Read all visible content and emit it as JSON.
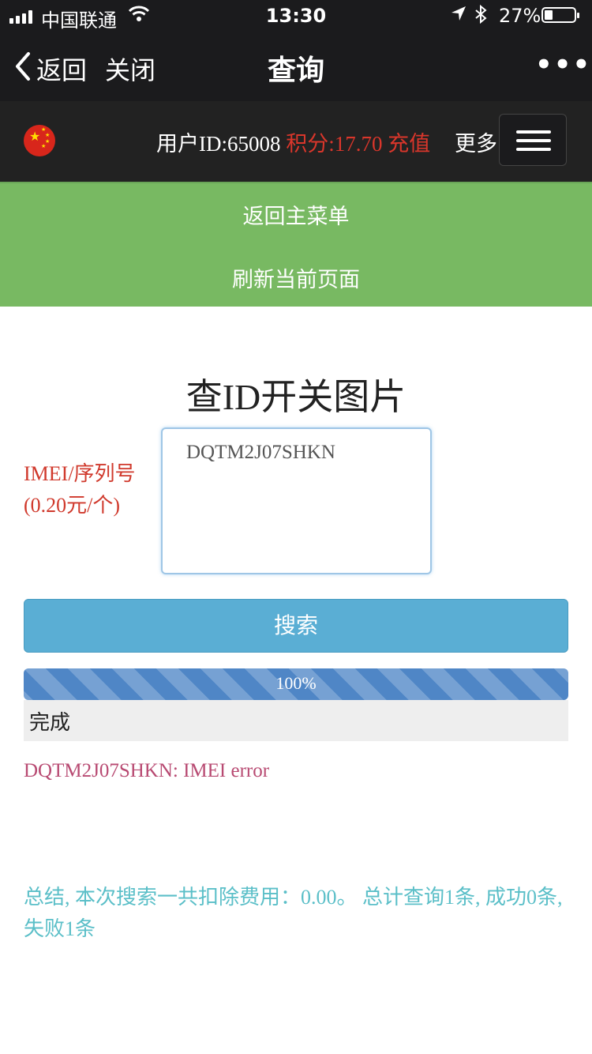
{
  "status_bar": {
    "carrier": "中国联通",
    "time": "13:30",
    "battery": "27%",
    "battery_level": 0.27,
    "icons": [
      "signal-icon",
      "wifi-icon",
      "location-icon",
      "bluetooth-icon",
      "battery-icon"
    ]
  },
  "nav": {
    "back_label": "返回",
    "close_label": "关闭",
    "title": "查询",
    "more_label": "•••"
  },
  "user_bar": {
    "user_id": "用户ID:65008",
    "score": "积分:17.70",
    "recharge": "充值",
    "more": "更多"
  },
  "menu": {
    "items": [
      "返回主菜单",
      "刷新当前页面"
    ]
  },
  "page": {
    "title": "查ID开关图片",
    "imei_label_line1": "IMEI/序列号",
    "imei_label_line2": "(0.20元/个)",
    "imei_value": "DQTM2J07SHKN",
    "search_button": "搜索",
    "progress_percent": 100,
    "progress_text": "100%",
    "status_text": "完成",
    "error_line": "DQTM2J07SHKN: IMEI error",
    "summary": "总结, 本次搜索一共扣除费用：0.00。 总计查询1条, 成功0条, 失败1条"
  },
  "colors": {
    "bar_bg": "#1b1b1d",
    "menu_green": "#78b962",
    "accent_red": "#d9362b",
    "button_blue": "#5aaed4",
    "progress_blue": "#4f86c6",
    "error_pink": "#b84a72",
    "summary_teal": "#5bbfc8"
  }
}
